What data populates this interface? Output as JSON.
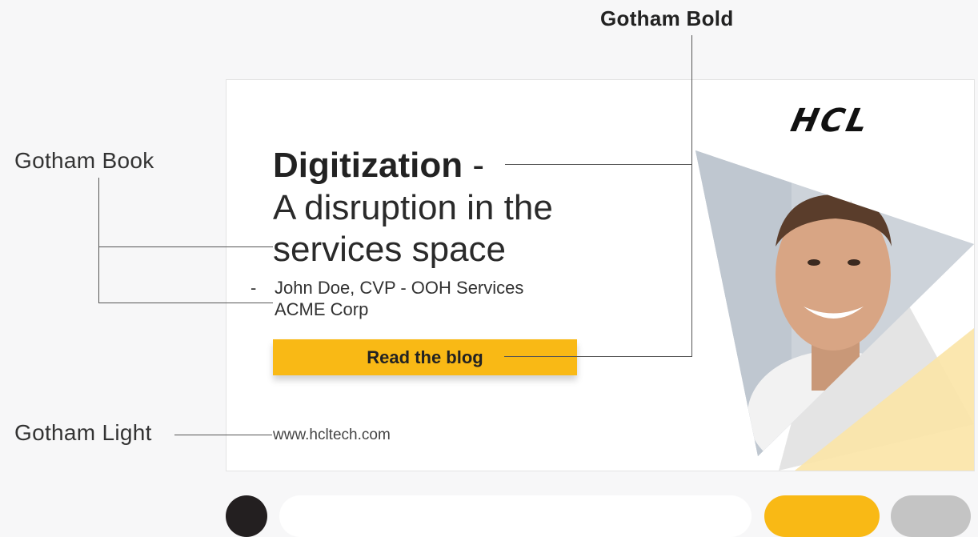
{
  "annotations": {
    "gotham_bold": "Gotham Bold",
    "gotham_book": "Gotham Book",
    "gotham_light": "Gotham Light"
  },
  "ad": {
    "logo": "HCL",
    "headline_bold": "Digitization",
    "headline_dash": " -",
    "headline_line2": "A disruption in the",
    "headline_line3": "services space",
    "author_dash": "-",
    "author_line1": "John Doe, CVP - OOH Services",
    "author_line2": "ACME Corp",
    "cta_label": "Read the blog",
    "url": "www.hcltech.com"
  },
  "palette": [
    {
      "name": "black",
      "color": "#231f20"
    },
    {
      "name": "white",
      "color": "#ffffff"
    },
    {
      "name": "yellow",
      "color": "#f9b915"
    },
    {
      "name": "gray",
      "color": "#c4c4c4"
    }
  ]
}
